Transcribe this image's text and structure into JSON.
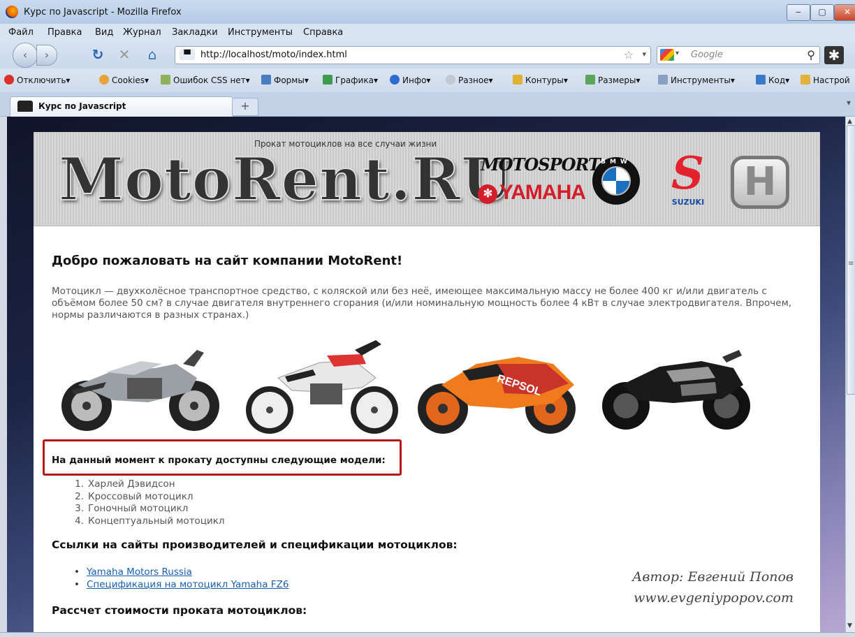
{
  "window": {
    "title": "Курс по Javascript - Mozilla Firefox",
    "buttons": {
      "minimize": "‒",
      "maximize": "▢",
      "close": "✕"
    }
  },
  "menu": [
    "Файл",
    "Правка",
    "Вид",
    "Журнал",
    "Закладки",
    "Инструменты",
    "Справка"
  ],
  "nav": {
    "url": "http://localhost/moto/index.html",
    "search_placeholder": "Google"
  },
  "devbar": [
    {
      "label": "Отключить▾",
      "icon": "disable-icon",
      "color": "#d9322b"
    },
    {
      "label": "Cookies▾",
      "icon": "cookies-icon",
      "color": "#e7a23a"
    },
    {
      "label": "Ошибок CSS нет▾",
      "icon": "css-icon",
      "color": "#8fb35a"
    },
    {
      "label": "Формы▾",
      "icon": "forms-icon",
      "color": "#4a7cc0"
    },
    {
      "label": "Графика▾",
      "icon": "images-icon",
      "color": "#3c9b4f"
    },
    {
      "label": "Инфо▾",
      "icon": "info-icon",
      "color": "#2f6ad2"
    },
    {
      "label": "Разное▾",
      "icon": "misc-icon",
      "color": "#c0c8d0"
    },
    {
      "label": "Контуры▾",
      "icon": "outline-icon",
      "color": "#e0b030"
    },
    {
      "label": "Размеры▾",
      "icon": "resize-icon",
      "color": "#5aa55a"
    },
    {
      "label": "Инструменты▾",
      "icon": "tools-icon",
      "color": "#8aa0c0"
    },
    {
      "label": "Код▾",
      "icon": "source-icon",
      "color": "#3a78c8"
    },
    {
      "label": "Настрой",
      "icon": "options-icon",
      "color": "#e2b23c"
    }
  ],
  "tab": {
    "label": "Курс по Javascript",
    "new_tab": "+"
  },
  "page": {
    "tagline": "Прокат мотоциклов на все случаи жизни",
    "logo": "MotoRent.RU",
    "brands": {
      "motosport": "MOTOSPORT",
      "yamaha": "YAMAHA",
      "bmw": "BMW",
      "suzuki": "SUZUKI",
      "honda": "H"
    },
    "welcome": "Добро пожаловать на сайт компании MotoRent!",
    "intro": "Мотоцикл — двухколёсное транспортное средство, с коляской или без неё, имеющее максимальную массу не более 400 кг и/или двигатель с объёмом более 50 см? в случае двигателя внутреннего сгорания (и/или номинальную мощность более 4 кВт в случае электродвигателя. Впрочем, нормы различаются в разных странах.)",
    "models_heading": "На данный момент к прокату доступны следующие модели:",
    "models": [
      "Харлей Дэвидсон",
      "Кроссовый мотоцикл",
      "Гоночный мотоцикл",
      "Концептуальный мотоцикл"
    ],
    "links_heading": "Ссылки на сайты производителей и спецификации мотоциклов:",
    "links": [
      "Yamaha Motors Russia",
      "Спецификация на мотоцикл Yamaha FZ6"
    ],
    "calc_heading": "Рассчет стоимости проката мотоциклов:",
    "author_line1": "Автор: Евгений Попов",
    "author_line2": "www.evgeniypopov.com"
  }
}
